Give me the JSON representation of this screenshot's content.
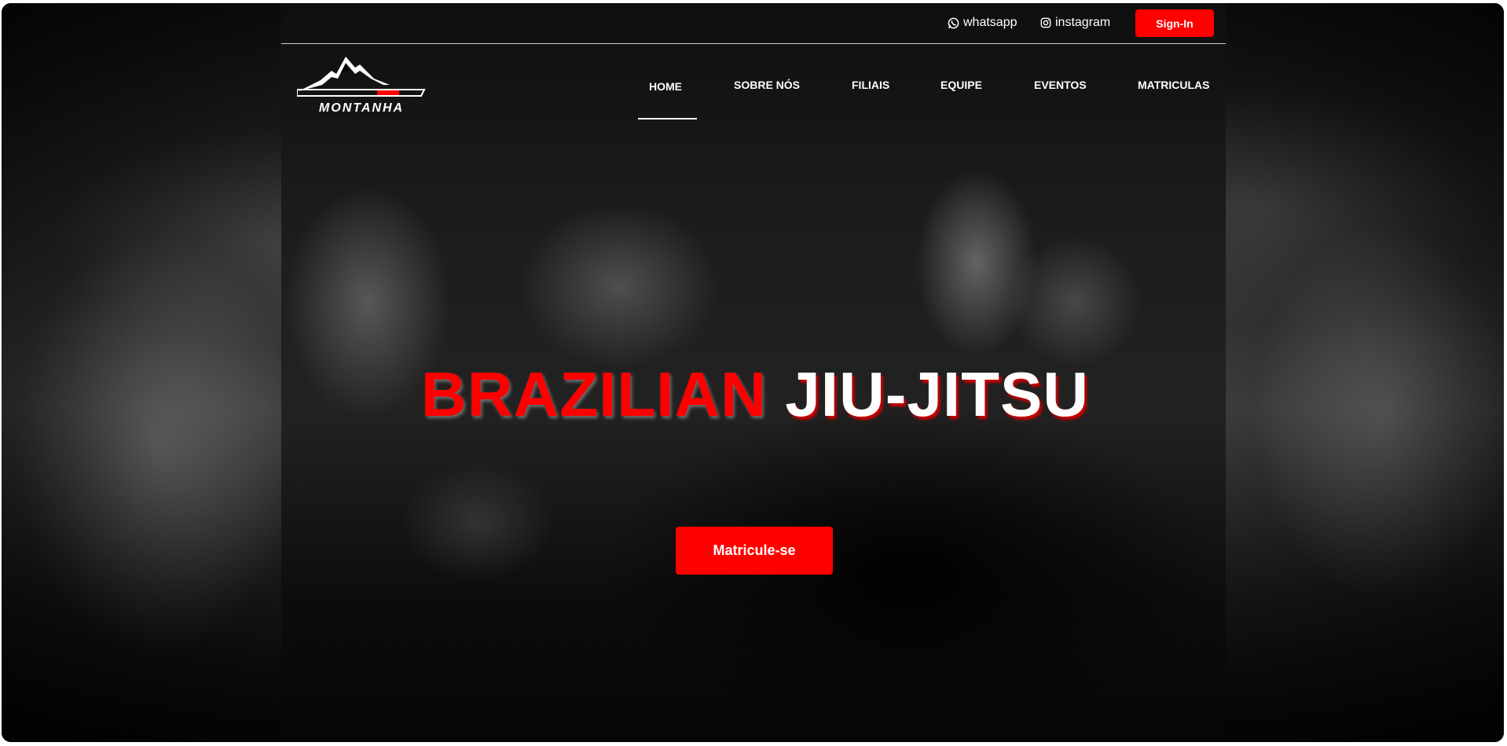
{
  "topbar": {
    "whatsapp_label": "whatsapp",
    "instagram_label": "instagram",
    "signin_label": "Sign-In"
  },
  "brand": {
    "logo_text": "MONTANHA"
  },
  "nav": {
    "items": [
      {
        "label": "HOME",
        "active": true
      },
      {
        "label": "SOBRE NÓS",
        "active": false
      },
      {
        "label": "FILIAIS",
        "active": false
      },
      {
        "label": "EQUIPE",
        "active": false
      },
      {
        "label": "EVENTOS",
        "active": false
      },
      {
        "label": "MATRICULAS",
        "active": false
      }
    ]
  },
  "hero": {
    "title_red": "BRAZILIAN",
    "title_white": "JIU-JITSU",
    "cta_label": "Matricule-se"
  },
  "colors": {
    "accent": "#ff0000",
    "text": "#ffffff",
    "background": "#000000"
  },
  "icons": {
    "whatsapp": "whatsapp-icon",
    "instagram": "instagram-icon",
    "logo": "mountain-logo-icon"
  }
}
